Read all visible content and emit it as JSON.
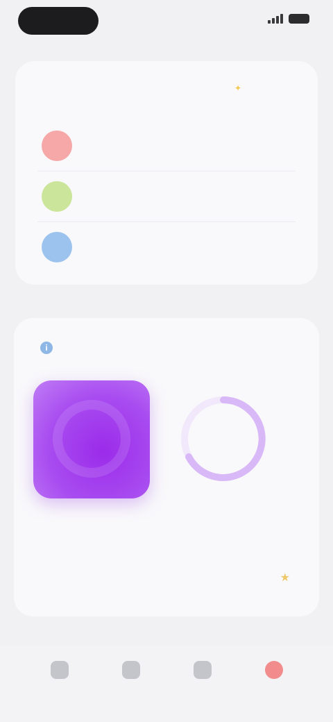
{
  "colors": {
    "row_1": "#f6a7a7",
    "row_2": "#cbe59a",
    "row_3": "#9cc3ee",
    "accent_purple": "#9b2bea",
    "ring": "#d9b8f7",
    "active_tab": "#ef7c7c"
  },
  "top_card": {
    "title": "",
    "rows": [
      {
        "label": "",
        "icon": "circle-icon"
      },
      {
        "label": "",
        "icon": "circle-icon"
      },
      {
        "label": "",
        "icon": "circle-icon"
      }
    ]
  },
  "main_card": {
    "title": "",
    "info_icon": "i",
    "tile_caption": "",
    "progress_label": "",
    "star_icon": "★"
  },
  "tabs": [
    {
      "label": "",
      "icon": "home-icon",
      "active": false
    },
    {
      "label": "",
      "icon": "grid-icon",
      "active": false
    },
    {
      "label": "",
      "icon": "bell-icon",
      "active": false
    },
    {
      "label": "",
      "icon": "profile-icon",
      "active": true
    }
  ]
}
